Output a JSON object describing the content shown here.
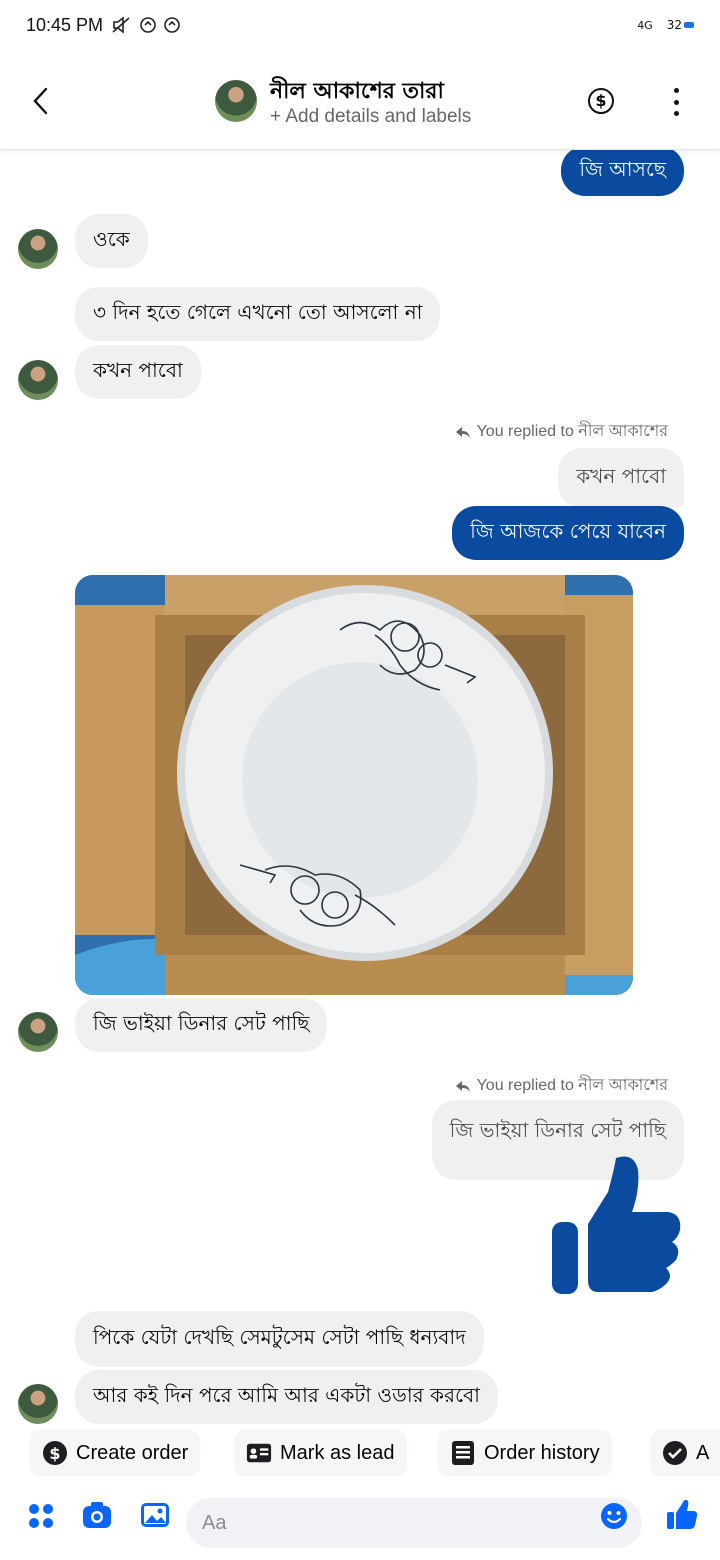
{
  "status_bar": {
    "time": "10:45 PM",
    "network": "4G",
    "battery": "32"
  },
  "header": {
    "contact_name": "নীল আকাশের তারা",
    "subtitle": "+ Add details and labels"
  },
  "messages": {
    "m1": "জি আসছে",
    "m2": "ওকে",
    "m3": "৩ দিন হতে গেলে এখনো তো আসলো না",
    "m4": "কখন পাবো",
    "reply1_label": "You replied to নীল আকাশের",
    "reply1_quote": "কখন পাবো",
    "m5": "জি আজকে পেয়ে যাবেন",
    "m6": "জি ভাইয়া ডিনার সেট পাছি",
    "reply2_label": "You replied to নীল আকাশের",
    "reply2_quote": "জি ভাইয়া ডিনার সেট পাছি",
    "m7": "পিকে যেটা দেখছি সেমটুসেম সেটা পাছি ধন্যবাদ",
    "m8": "আর কই দিন পরে আমি আর একটা ওডার করবো"
  },
  "quick_actions": {
    "create_order": "Create order",
    "mark_as_lead": "Mark as lead",
    "order_history": "Order history",
    "fourth": "A"
  },
  "composer": {
    "placeholder": "Aa"
  },
  "colors": {
    "outgoing_bubble": "#0a4ba0",
    "incoming_bubble": "#f0f0f0",
    "accent": "#0866ff"
  }
}
